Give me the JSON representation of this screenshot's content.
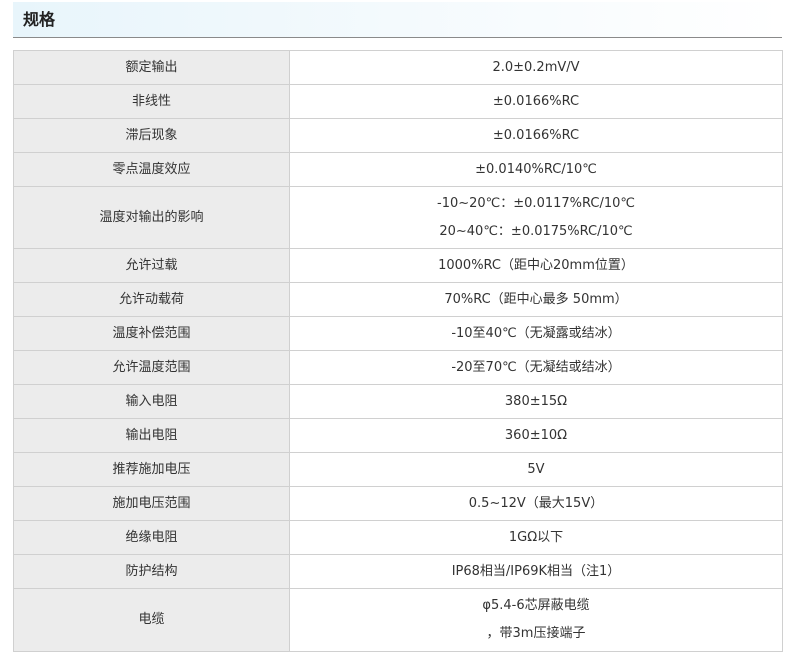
{
  "section_title": "规格",
  "rows": [
    {
      "label": "额定输出",
      "value": [
        "2.0±0.2mV/V"
      ]
    },
    {
      "label": "非线性",
      "value": [
        "±0.0166%RC"
      ]
    },
    {
      "label": "滞后现象",
      "value": [
        "±0.0166%RC"
      ]
    },
    {
      "label": "零点温度效应",
      "value": [
        "±0.0140%RC/10℃"
      ]
    },
    {
      "label": "温度对输出的影响",
      "value": [
        "-10~20℃：±0.0117%RC/10℃",
        "20~40℃：±0.0175%RC/10℃"
      ]
    },
    {
      "label": "允许过载",
      "value": [
        "1000%RC（距中心20mm位置）"
      ]
    },
    {
      "label": "允许动载荷",
      "value": [
        "70%RC（距中心最多 50mm）"
      ]
    },
    {
      "label": "温度补偿范围",
      "value": [
        "-10至40℃（无凝露或结冰）"
      ]
    },
    {
      "label": "允许温度范围",
      "value": [
        "-20至70℃（无凝结或结冰）"
      ]
    },
    {
      "label": "输入电阻",
      "value": [
        "380±15Ω"
      ]
    },
    {
      "label": "输出电阻",
      "value": [
        "360±10Ω"
      ]
    },
    {
      "label": "推荐施加电压",
      "value": [
        "5V"
      ]
    },
    {
      "label": "施加电压范围",
      "value": [
        "0.5~12V（最大15V）"
      ]
    },
    {
      "label": "绝缘电阻",
      "value": [
        "1GΩ以下"
      ]
    },
    {
      "label": "防护结构",
      "value": [
        "IP68相当/IP69K相当（注1）"
      ]
    },
    {
      "label": "电缆",
      "value": [
        "φ5.4-6芯屏蔽电缆",
        "，带3m压接端子"
      ]
    }
  ]
}
